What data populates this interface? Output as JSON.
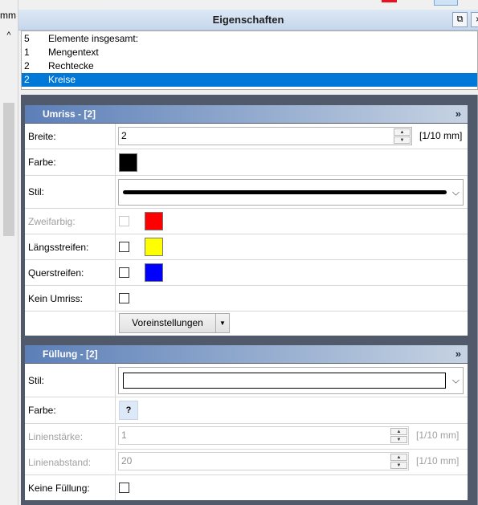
{
  "left": {
    "unit_label": "mm",
    "scroll_up_glyph": "^"
  },
  "window": {
    "title": "Eigenschaften",
    "dock_glyph": "⧉",
    "close_glyph": "×"
  },
  "selection": [
    {
      "count": "5",
      "name": "Elemente insgesamt:"
    },
    {
      "count": "1",
      "name": "Mengentext"
    },
    {
      "count": "2",
      "name": "Rechtecke"
    },
    {
      "count": "2",
      "name": "Kreise",
      "selected": true
    }
  ],
  "outline": {
    "header": "Umriss - [2]",
    "chevron": "»",
    "width_label": "Breite:",
    "width_value": "2",
    "width_unit": "[1/10 mm]",
    "color_label": "Farbe:",
    "color_value": "#000000",
    "style_label": "Stil:",
    "twocolor_label": "Zweifarbig:",
    "twocolor_color": "#ff0000",
    "long_stripes_label": "Längsstreifen:",
    "long_stripes_color": "#ffff00",
    "cross_stripes_label": "Querstreifen:",
    "cross_stripes_color": "#0000ff",
    "no_outline_label": "Kein Umriss:",
    "presets_label": "Voreinstellungen"
  },
  "fill": {
    "header": "Füllung  -  [2]",
    "chevron": "»",
    "style_label": "Stil:",
    "color_label": "Farbe:",
    "color_button": "?",
    "line_width_label": "Linienstärke:",
    "line_width_value": "1",
    "line_width_unit": "[1/10 mm]",
    "line_spacing_label": "Linienabstand:",
    "line_spacing_value": "20",
    "line_spacing_unit": "[1/10 mm]",
    "no_fill_label": "Keine Füllung:"
  },
  "icons": {
    "spin_up": "▲",
    "spin_down": "▼",
    "combo_arrow": "⌵",
    "dropdown": "▼"
  }
}
